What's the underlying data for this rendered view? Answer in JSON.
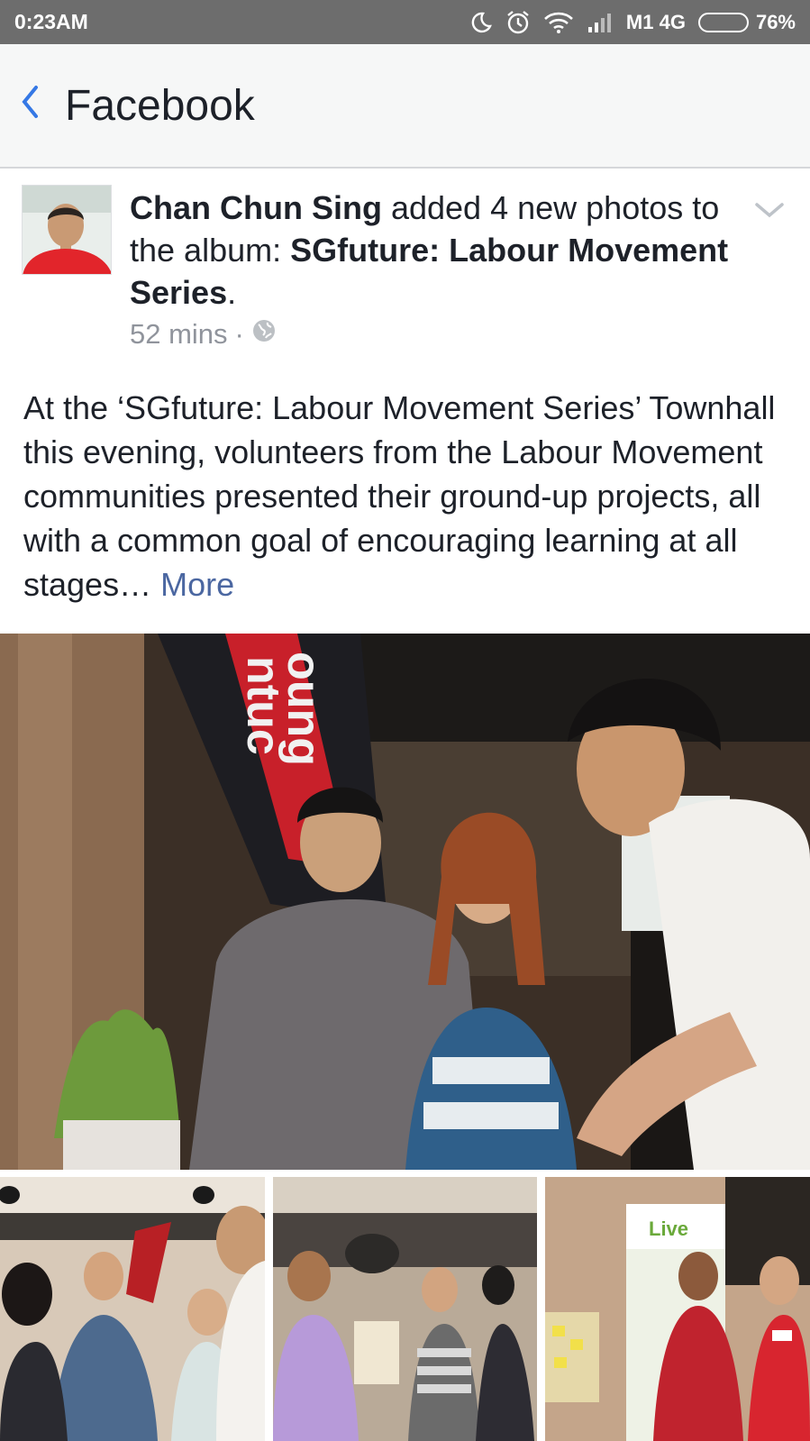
{
  "status_bar": {
    "time": "0:23AM",
    "carrier": "M1 4G",
    "battery_percent": "76%",
    "battery_level": 0.76,
    "icons": [
      "moon-icon",
      "alarm-icon",
      "wifi-icon",
      "signal-icon",
      "battery-icon"
    ]
  },
  "nav": {
    "back_icon": "chevron-left-icon",
    "title": "Facebook"
  },
  "post": {
    "author": "Chan Chun Sing",
    "action_text": " added 4 new photos to the album: ",
    "album": "SGfuture: Labour Movement Series",
    "period": ".",
    "time_ago": "52 mins",
    "separator": "·",
    "privacy_icon": "globe-icon",
    "menu_icon": "chevron-down-icon",
    "body": "At the ‘SGfuture: Labour Movement Series’ Townhall this evening, volunteers from the Labour Movement communities presented their ground-up projects, all with a common goal of encouraging learning at all stages… ",
    "more_label": "More"
  },
  "photos": {
    "main_banner_text": "ntuc",
    "main_banner_text_2": "oung",
    "thumb_3_sign": "Live",
    "accent_color": "#3578e5",
    "link_color": "#4b67a1"
  }
}
